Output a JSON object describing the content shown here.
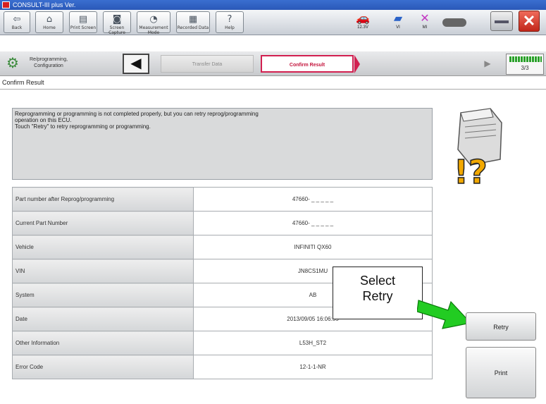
{
  "window": {
    "title": "CONSULT-III plus  Ver."
  },
  "toolbar": {
    "buttons": [
      {
        "label": "Back",
        "icon": "back-icon"
      },
      {
        "label": "Home",
        "icon": "home-icon"
      },
      {
        "label": "Print Screen",
        "icon": "print-screen-icon"
      },
      {
        "label": "Screen Capture",
        "icon": "camera-icon"
      },
      {
        "label": "Measurement Mode",
        "icon": "measurement-icon"
      },
      {
        "label": "Recorded Data",
        "icon": "recorded-data-icon"
      },
      {
        "label": "Help",
        "icon": "help-icon"
      }
    ],
    "status": [
      {
        "label": "12.3V",
        "icon": "vehicle-battery-icon"
      },
      {
        "label": "VI",
        "icon": "vi-icon"
      },
      {
        "label": "MI",
        "icon": "mi-disconnected-icon"
      }
    ]
  },
  "process": {
    "category_label": "Re/programming, Configuration",
    "steps": [
      {
        "label": "Transfer Data"
      },
      {
        "label": "Confirm Result"
      }
    ],
    "page": "3/3"
  },
  "main": {
    "section_title": "Confirm Result",
    "message_lines": [
      "Reprogramming or programming is not completed properly, but you can retry reprog/programming",
      "operation on this ECU.",
      "Touch \"Retry\" to retry reprogramming or programming."
    ],
    "table_rows": [
      {
        "label": "Part number after Reprog/programming",
        "value": "47660- _ _ _ _ _"
      },
      {
        "label": "Current Part Number",
        "value": "47660- _ _ _ _ _"
      },
      {
        "label": "Vehicle",
        "value": "INFINITI QX60"
      },
      {
        "label": "VIN",
        "value": "JN8CS1MU"
      },
      {
        "label": "System",
        "value": "AB"
      },
      {
        "label": "Date",
        "value": "2013/09/05 16:06:55"
      },
      {
        "label": "Other Information",
        "value": "L53H_ST2"
      },
      {
        "label": "Error Code",
        "value": "12-1-1-NR"
      }
    ]
  },
  "callout": {
    "line1": "Select",
    "line2": "Retry"
  },
  "actions": {
    "retry_label": "Retry",
    "print_label": "Print"
  },
  "colors": {
    "active_step": "#d22050",
    "callout_arrow": "#22cc22",
    "close": "#d63a2a"
  }
}
